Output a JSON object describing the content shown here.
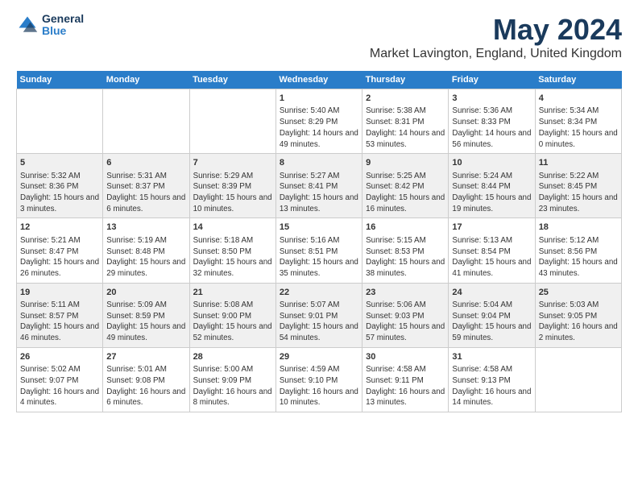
{
  "logo": {
    "general": "General",
    "blue": "Blue"
  },
  "title": "May 2024",
  "location": "Market Lavington, England, United Kingdom",
  "days_of_week": [
    "Sunday",
    "Monday",
    "Tuesday",
    "Wednesday",
    "Thursday",
    "Friday",
    "Saturday"
  ],
  "weeks": [
    [
      {
        "day": "",
        "info": ""
      },
      {
        "day": "",
        "info": ""
      },
      {
        "day": "",
        "info": ""
      },
      {
        "day": "1",
        "info": "Sunrise: 5:40 AM\nSunset: 8:29 PM\nDaylight: 14 hours and 49 minutes."
      },
      {
        "day": "2",
        "info": "Sunrise: 5:38 AM\nSunset: 8:31 PM\nDaylight: 14 hours and 53 minutes."
      },
      {
        "day": "3",
        "info": "Sunrise: 5:36 AM\nSunset: 8:33 PM\nDaylight: 14 hours and 56 minutes."
      },
      {
        "day": "4",
        "info": "Sunrise: 5:34 AM\nSunset: 8:34 PM\nDaylight: 15 hours and 0 minutes."
      }
    ],
    [
      {
        "day": "5",
        "info": "Sunrise: 5:32 AM\nSunset: 8:36 PM\nDaylight: 15 hours and 3 minutes."
      },
      {
        "day": "6",
        "info": "Sunrise: 5:31 AM\nSunset: 8:37 PM\nDaylight: 15 hours and 6 minutes."
      },
      {
        "day": "7",
        "info": "Sunrise: 5:29 AM\nSunset: 8:39 PM\nDaylight: 15 hours and 10 minutes."
      },
      {
        "day": "8",
        "info": "Sunrise: 5:27 AM\nSunset: 8:41 PM\nDaylight: 15 hours and 13 minutes."
      },
      {
        "day": "9",
        "info": "Sunrise: 5:25 AM\nSunset: 8:42 PM\nDaylight: 15 hours and 16 minutes."
      },
      {
        "day": "10",
        "info": "Sunrise: 5:24 AM\nSunset: 8:44 PM\nDaylight: 15 hours and 19 minutes."
      },
      {
        "day": "11",
        "info": "Sunrise: 5:22 AM\nSunset: 8:45 PM\nDaylight: 15 hours and 23 minutes."
      }
    ],
    [
      {
        "day": "12",
        "info": "Sunrise: 5:21 AM\nSunset: 8:47 PM\nDaylight: 15 hours and 26 minutes."
      },
      {
        "day": "13",
        "info": "Sunrise: 5:19 AM\nSunset: 8:48 PM\nDaylight: 15 hours and 29 minutes."
      },
      {
        "day": "14",
        "info": "Sunrise: 5:18 AM\nSunset: 8:50 PM\nDaylight: 15 hours and 32 minutes."
      },
      {
        "day": "15",
        "info": "Sunrise: 5:16 AM\nSunset: 8:51 PM\nDaylight: 15 hours and 35 minutes."
      },
      {
        "day": "16",
        "info": "Sunrise: 5:15 AM\nSunset: 8:53 PM\nDaylight: 15 hours and 38 minutes."
      },
      {
        "day": "17",
        "info": "Sunrise: 5:13 AM\nSunset: 8:54 PM\nDaylight: 15 hours and 41 minutes."
      },
      {
        "day": "18",
        "info": "Sunrise: 5:12 AM\nSunset: 8:56 PM\nDaylight: 15 hours and 43 minutes."
      }
    ],
    [
      {
        "day": "19",
        "info": "Sunrise: 5:11 AM\nSunset: 8:57 PM\nDaylight: 15 hours and 46 minutes."
      },
      {
        "day": "20",
        "info": "Sunrise: 5:09 AM\nSunset: 8:59 PM\nDaylight: 15 hours and 49 minutes."
      },
      {
        "day": "21",
        "info": "Sunrise: 5:08 AM\nSunset: 9:00 PM\nDaylight: 15 hours and 52 minutes."
      },
      {
        "day": "22",
        "info": "Sunrise: 5:07 AM\nSunset: 9:01 PM\nDaylight: 15 hours and 54 minutes."
      },
      {
        "day": "23",
        "info": "Sunrise: 5:06 AM\nSunset: 9:03 PM\nDaylight: 15 hours and 57 minutes."
      },
      {
        "day": "24",
        "info": "Sunrise: 5:04 AM\nSunset: 9:04 PM\nDaylight: 15 hours and 59 minutes."
      },
      {
        "day": "25",
        "info": "Sunrise: 5:03 AM\nSunset: 9:05 PM\nDaylight: 16 hours and 2 minutes."
      }
    ],
    [
      {
        "day": "26",
        "info": "Sunrise: 5:02 AM\nSunset: 9:07 PM\nDaylight: 16 hours and 4 minutes."
      },
      {
        "day": "27",
        "info": "Sunrise: 5:01 AM\nSunset: 9:08 PM\nDaylight: 16 hours and 6 minutes."
      },
      {
        "day": "28",
        "info": "Sunrise: 5:00 AM\nSunset: 9:09 PM\nDaylight: 16 hours and 8 minutes."
      },
      {
        "day": "29",
        "info": "Sunrise: 4:59 AM\nSunset: 9:10 PM\nDaylight: 16 hours and 10 minutes."
      },
      {
        "day": "30",
        "info": "Sunrise: 4:58 AM\nSunset: 9:11 PM\nDaylight: 16 hours and 13 minutes."
      },
      {
        "day": "31",
        "info": "Sunrise: 4:58 AM\nSunset: 9:13 PM\nDaylight: 16 hours and 14 minutes."
      },
      {
        "day": "",
        "info": ""
      }
    ]
  ]
}
